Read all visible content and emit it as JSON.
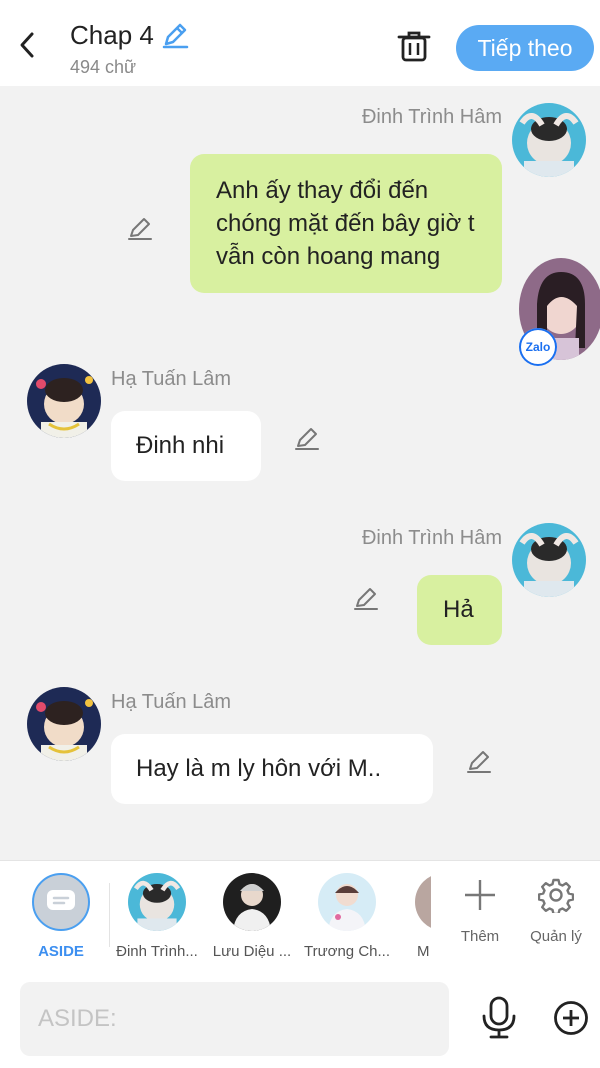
{
  "header": {
    "title": "Chap 4",
    "word_count": "494 chữ",
    "next_label": "Tiếp theo",
    "icons": {
      "back": "chevron-left-icon",
      "edit": "pencil-icon",
      "trash": "trash-icon"
    }
  },
  "messages": [
    {
      "sender": "Đinh Trình Hâm",
      "side": "right",
      "text": "Anh ấy thay đổi đến chóng mặt đến bây giờ t vẫn còn hoang mang",
      "bubble_color": "#d8f0a0"
    },
    {
      "sender": "Hạ Tuấn Lâm",
      "side": "left",
      "text": "Đinh nhi",
      "bubble_color": "#ffffff"
    },
    {
      "sender": "Đinh Trình Hâm",
      "side": "right",
      "text": "Hả",
      "bubble_color": "#d8f0a0"
    },
    {
      "sender": "Hạ Tuấn Lâm",
      "side": "left",
      "text": "Hay là m ly hôn với M..",
      "bubble_color": "#ffffff"
    }
  ],
  "floating_badge": {
    "label": "Zalo"
  },
  "characters": [
    {
      "name": "ASIDE",
      "selected": true
    },
    {
      "name": "Đinh Trình..."
    },
    {
      "name": "Lưu Diệu ..."
    },
    {
      "name": "Trương Ch..."
    },
    {
      "name": "M"
    }
  ],
  "tools": [
    {
      "label": "Thêm",
      "icon": "plus-icon"
    },
    {
      "label": "Quản lý",
      "icon": "gear-icon"
    }
  ],
  "input": {
    "placeholder": "ASIDE:",
    "value": ""
  },
  "colors": {
    "accent": "#5aaaf3",
    "my_bubble": "#d8f0a0",
    "other_bubble": "#ffffff",
    "background": "#f2f2f2"
  }
}
